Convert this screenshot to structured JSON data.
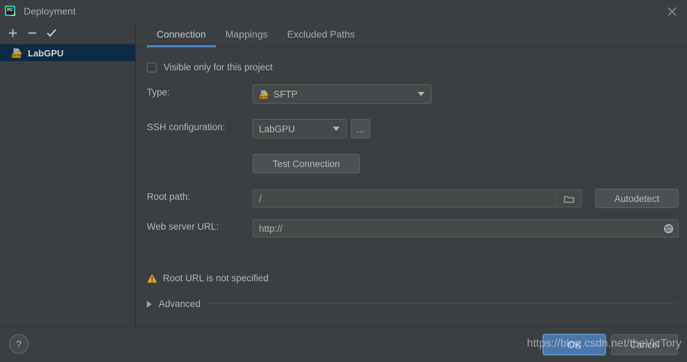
{
  "window": {
    "title": "Deployment",
    "app_icon": "pycharm-icon",
    "close_icon": "close-icon"
  },
  "sidebar": {
    "toolbar": [
      {
        "name": "add-button",
        "icon": "plus-icon"
      },
      {
        "name": "remove-button",
        "icon": "minus-icon"
      },
      {
        "name": "set-default-button",
        "icon": "check-icon"
      }
    ],
    "items": [
      {
        "label": "LabGPU",
        "icon": "sftp-icon",
        "selected": true
      }
    ]
  },
  "tabs": [
    {
      "label": "Connection",
      "active": true
    },
    {
      "label": "Mappings",
      "active": false
    },
    {
      "label": "Excluded Paths",
      "active": false
    }
  ],
  "form": {
    "visible_only_checkbox": {
      "label": "Visible only for this project",
      "checked": false
    },
    "type": {
      "label": "Type:",
      "value": "SFTP",
      "icon": "sftp-icon"
    },
    "ssh_configuration": {
      "label": "SSH configuration:",
      "value": "LabGPU",
      "browse_label": "..."
    },
    "test_connection_label": "Test Connection",
    "root_path": {
      "label": "Root path:",
      "value": "/",
      "browse_icon": "folder-icon",
      "autodetect_label": "Autodetect"
    },
    "web_server_url": {
      "label": "Web server URL:",
      "value": "http://",
      "open_icon": "globe-icon"
    },
    "warning": {
      "icon": "warning-icon",
      "text": "Root URL is not specified"
    },
    "advanced": {
      "label": "Advanced",
      "expanded": false,
      "icon": "triangle-right-icon"
    }
  },
  "footer": {
    "help_label": "?",
    "ok_label": "OK",
    "cancel_label": "Cancel"
  },
  "watermark": {
    "text": "https://blog.csdn.net/theVicTory"
  },
  "colors": {
    "background": "#3c3f41",
    "accent_blue": "#4a88c7",
    "selection_navy": "#0d2b45",
    "warning_amber": "#f0a732",
    "ok_button": "#4a77aa"
  }
}
